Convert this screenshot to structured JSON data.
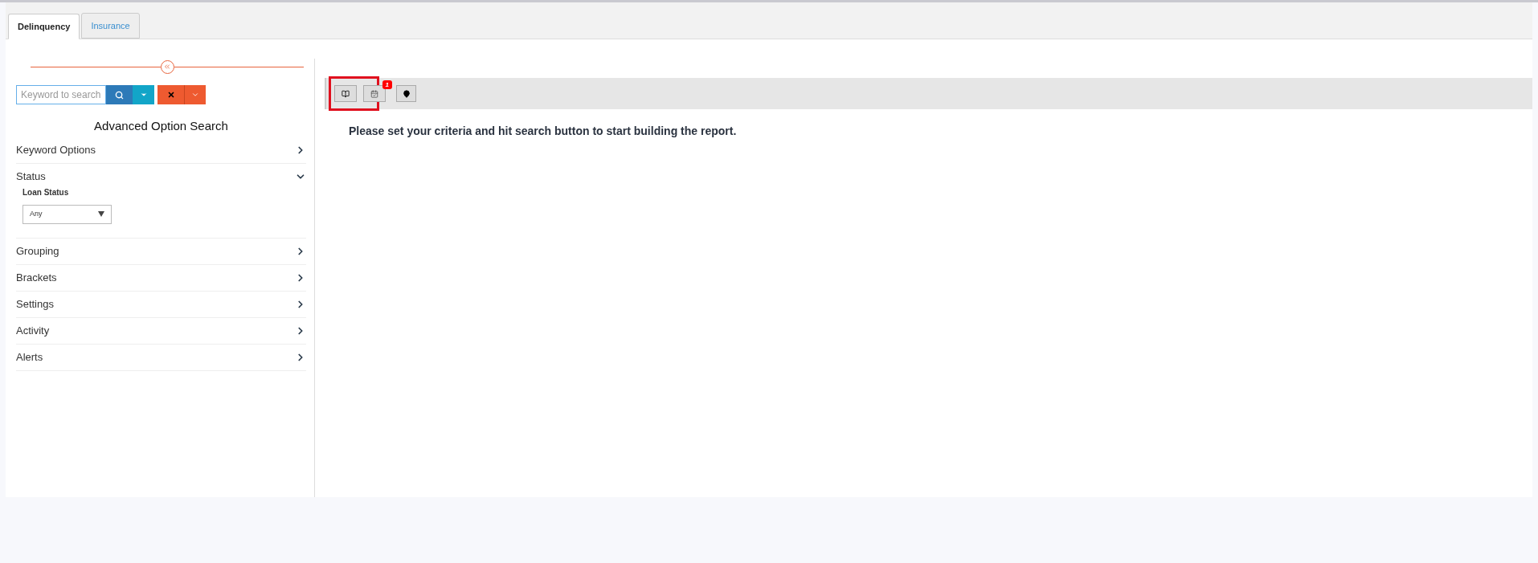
{
  "tabs": [
    {
      "label": "Delinquency",
      "selected": true
    },
    {
      "label": "Insurance",
      "selected": false
    }
  ],
  "search": {
    "placeholder": "Keyword to search"
  },
  "sidebar": {
    "title": "Advanced Option Search",
    "sections": [
      {
        "label": "Keyword Options",
        "expanded": false
      },
      {
        "label": "Status",
        "expanded": true,
        "field": {
          "label": "Loan Status",
          "value": "Any"
        }
      },
      {
        "label": "Grouping",
        "expanded": false
      },
      {
        "label": "Brackets",
        "expanded": false
      },
      {
        "label": "Settings",
        "expanded": false
      },
      {
        "label": "Activity",
        "expanded": false
      },
      {
        "label": "Alerts",
        "expanded": false
      }
    ]
  },
  "toolbar": {
    "badge": "1"
  },
  "message": "Please set your criteria and hit search button to start building the report."
}
